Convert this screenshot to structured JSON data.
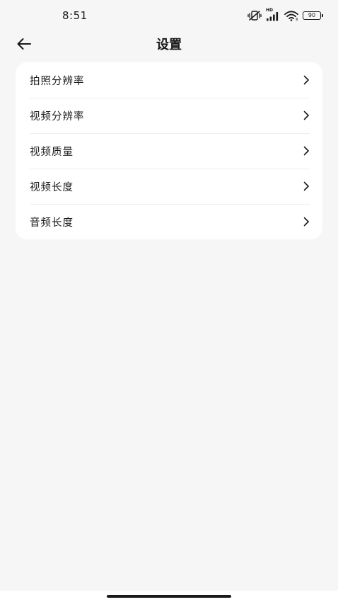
{
  "status_bar": {
    "time": "8:51",
    "network_label": "HD",
    "battery_level": "90",
    "icons": [
      "vibrate-off-icon",
      "signal-icon",
      "wifi-icon",
      "battery-icon"
    ]
  },
  "header": {
    "title": "设置",
    "back_icon": "arrow-left-icon"
  },
  "settings": {
    "items": [
      {
        "label": "拍照分辨率"
      },
      {
        "label": "视频分辨率"
      },
      {
        "label": "视频质量"
      },
      {
        "label": "视频长度"
      },
      {
        "label": "音频长度"
      }
    ],
    "chevron_icon": "chevron-right-icon"
  },
  "colors": {
    "background": "#f6f6f6",
    "card": "#ffffff",
    "text": "#1a1a1a"
  }
}
